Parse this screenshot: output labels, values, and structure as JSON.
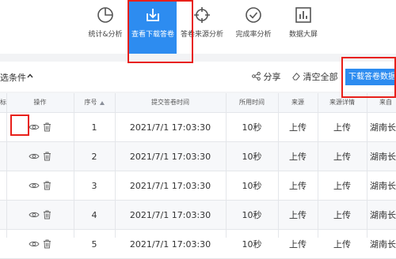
{
  "toolbar": {
    "items": [
      {
        "label": "统计&分析",
        "icon": "pie-chart-icon"
      },
      {
        "label": "查看下载答卷",
        "icon": "download-icon",
        "active": true
      },
      {
        "label": "答卷来源分析",
        "icon": "crosshair-icon"
      },
      {
        "label": "完成率分析",
        "icon": "check-circle-icon"
      },
      {
        "label": "数据大屏",
        "icon": "bar-chart-icon"
      }
    ]
  },
  "filter": {
    "label": "选条件",
    "share_label": "分享",
    "clear_label": "清空全部",
    "download_data_label": "下载答卷数据"
  },
  "table": {
    "headers": [
      "标",
      "操作",
      "序号",
      "提交答卷时间",
      "所用时间",
      "来源",
      "来源详情",
      "来自"
    ],
    "rows": [
      {
        "index": "1",
        "time": "2021/7/1 17:03:30",
        "duration": "10秒",
        "source": "上传",
        "source_detail": "上传",
        "from": "湖南长沙"
      },
      {
        "index": "2",
        "time": "2021/7/1 17:03:30",
        "duration": "10秒",
        "source": "上传",
        "source_detail": "上传",
        "from": "湖南长沙"
      },
      {
        "index": "3",
        "time": "2021/7/1 17:03:30",
        "duration": "10秒",
        "source": "上传",
        "source_detail": "上传",
        "from": "湖南长沙"
      },
      {
        "index": "4",
        "time": "2021/7/1 17:03:30",
        "duration": "10秒",
        "source": "上传",
        "source_detail": "上传",
        "from": "湖南长沙"
      },
      {
        "index": "5",
        "time": "2021/7/1 17:03:30",
        "duration": "10秒",
        "source": "上传",
        "source_detail": "上传",
        "from": "湖南长沙"
      }
    ]
  },
  "colors": {
    "accent": "#2d8cf0",
    "highlight": "#e8201a"
  }
}
